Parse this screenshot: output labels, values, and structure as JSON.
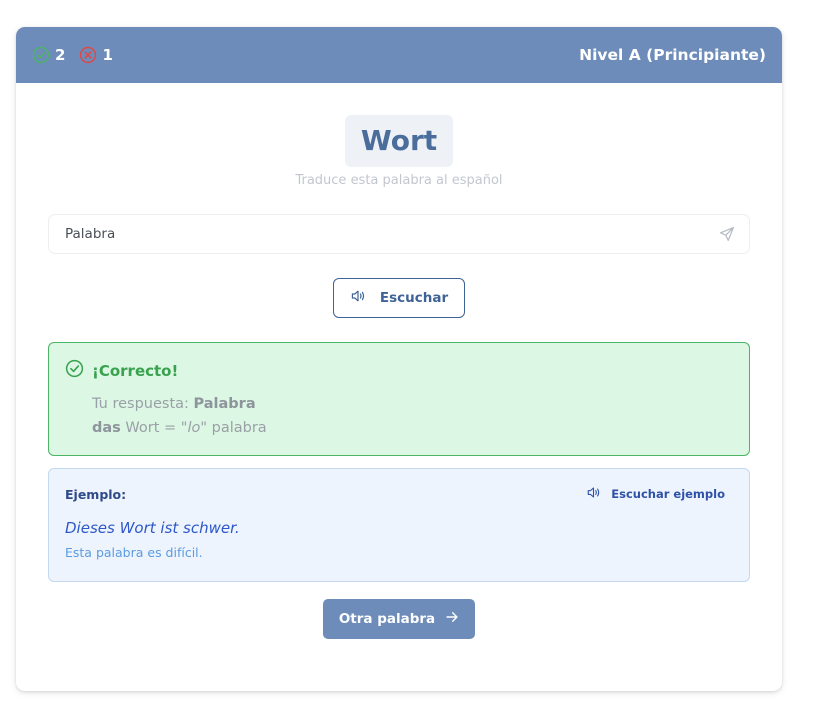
{
  "header": {
    "correct_count": "2",
    "wrong_count": "1",
    "level": "Nivel A (Principiante)"
  },
  "word": {
    "term": "Wort",
    "hint": "Traduce esta palabra al español"
  },
  "answer": {
    "value": "Palabra",
    "placeholder": "Palabra"
  },
  "listen": {
    "label": "Escuchar"
  },
  "feedback": {
    "title": "¡Correcto!",
    "response_label": "Tu respuesta:",
    "response_value": "Palabra",
    "article": "das",
    "term": "Wort =",
    "article_es": "\"lo\"",
    "translation": "palabra"
  },
  "example": {
    "label": "Ejemplo:",
    "listen_label": "Escuchar ejemplo",
    "sentence": "Dieses Wort ist schwer.",
    "translation": "Esta palabra es difícil."
  },
  "next": {
    "label": "Otra palabra"
  },
  "colors": {
    "header": "#6d8cba",
    "success": "#3aa24f",
    "error": "#e04848",
    "primary": "#3f6396"
  },
  "icons": {
    "correct": "check-circle-icon",
    "wrong": "x-circle-icon",
    "send": "send-icon",
    "speaker": "speaker-icon",
    "arrow": "arrow-right-icon"
  }
}
